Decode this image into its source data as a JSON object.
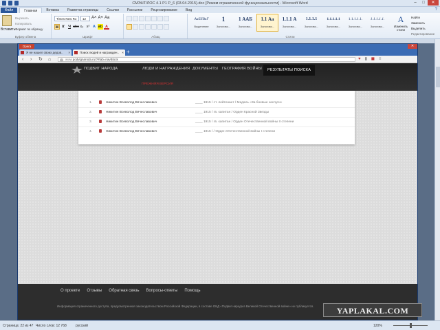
{
  "word": {
    "window_title": "СМЭНТ/ЛОС 4.1 Р1 Р_6 (03.04.2015).doc [Режим ограниченной функциональности] - Microsoft Word",
    "ribbon_tabs": [
      "Файл",
      "Главная",
      "Вставка",
      "Разметка страницы",
      "Ссылки",
      "Рассылки",
      "Рецензирование",
      "Вид"
    ],
    "clipboard": {
      "paste": "Вставить",
      "cut": "Вырезать",
      "copy": "Копировать",
      "format_painter": "Формат по образцу",
      "group": "Буфер обмена"
    },
    "font": {
      "name": "Times New Ro",
      "size": "12",
      "group": "Шрифт"
    },
    "paragraph_group": "Абзац",
    "styles": [
      {
        "sample": "АаБбВвГ",
        "name": "Выделение"
      },
      {
        "sample": "1",
        "name": "Заголово..."
      },
      {
        "sample": "1 ААБ",
        "name": "Заголово..."
      },
      {
        "sample": "1.1 Аа",
        "name": "Заголово..."
      },
      {
        "sample": "1.1.1 А",
        "name": "Заголово..."
      },
      {
        "sample": "1.1.1.1",
        "name": "Заголово..."
      },
      {
        "sample": "1.1.1.1.1",
        "name": "Заголово..."
      },
      {
        "sample": "1.1.1.1.1.",
        "name": "Заголово..."
      },
      {
        "sample": "1.1.1.1.1.",
        "name": "Заголово..."
      }
    ],
    "styles_group": "Стили",
    "change_styles": "Изменить стили",
    "editing": {
      "find": "Найти",
      "replace": "Заменить",
      "select": "Выделить",
      "group": "Редактирование"
    },
    "status": {
      "page": "Страница: 22 из 47",
      "words": "Число слов: 12 768",
      "language": "русский",
      "zoom": "120%"
    }
  },
  "browser": {
    "orb_label": "Opera",
    "tabs": [
      {
        "label": "Я не нашел своих дедов..",
        "active": false
      },
      {
        "label": "Поиск людей и награжден..",
        "active": true
      }
    ],
    "url_domain": "www.",
    "url_rest": "podvignaroda.ru/?#tab=navBlock"
  },
  "site": {
    "logo_alt": "Подвиг народа",
    "menu": [
      "ПОДВИГ НАРОДА",
      "ЛЮДИ И НАГРАЖДЕНИЯ",
      "ДОКУМЕНТЫ",
      "ГЕОГРАФИЯ ВОЙНЫ",
      "РЕЗУЛЬТАТЫ ПОИСКА"
    ],
    "old_version": "ПРЕЖНЯЯ ВЕРСИЯ",
    "results": [
      {
        "num": "1.",
        "name": "Никитин Всеволод Вячеславович",
        "award": "____ 1915 /  ст. лейтенант /  Медаль «За боевые заслуги»"
      },
      {
        "num": "2.",
        "name": "Никитин Всеволод Вячеславович",
        "award": "____ 1915 /  гв. капитан /  Орден Красной Звезды"
      },
      {
        "num": "3.",
        "name": "Никитин Всеволод Вячеславович",
        "award": "____ 1915 /  гв. капитан /  Орден Отечественной войны II степени"
      },
      {
        "num": "4.",
        "name": "Никитин Всеволод Вячеславович",
        "award": "____ 1915 /  /  Орден Отечественной войны I степени"
      }
    ],
    "footer_links": [
      "О проекте",
      "Отзывы",
      "Обратная связь",
      "Вопросы-ответы",
      "Помощь"
    ],
    "footer_text": "Информация ограниченного доступа, предусмотренная законодательством Российской Федерации, в составе ОБД «Подвиг народа в Великой Отечественной войне» не публикуется."
  },
  "watermark": "YAPLAKAL.COM"
}
